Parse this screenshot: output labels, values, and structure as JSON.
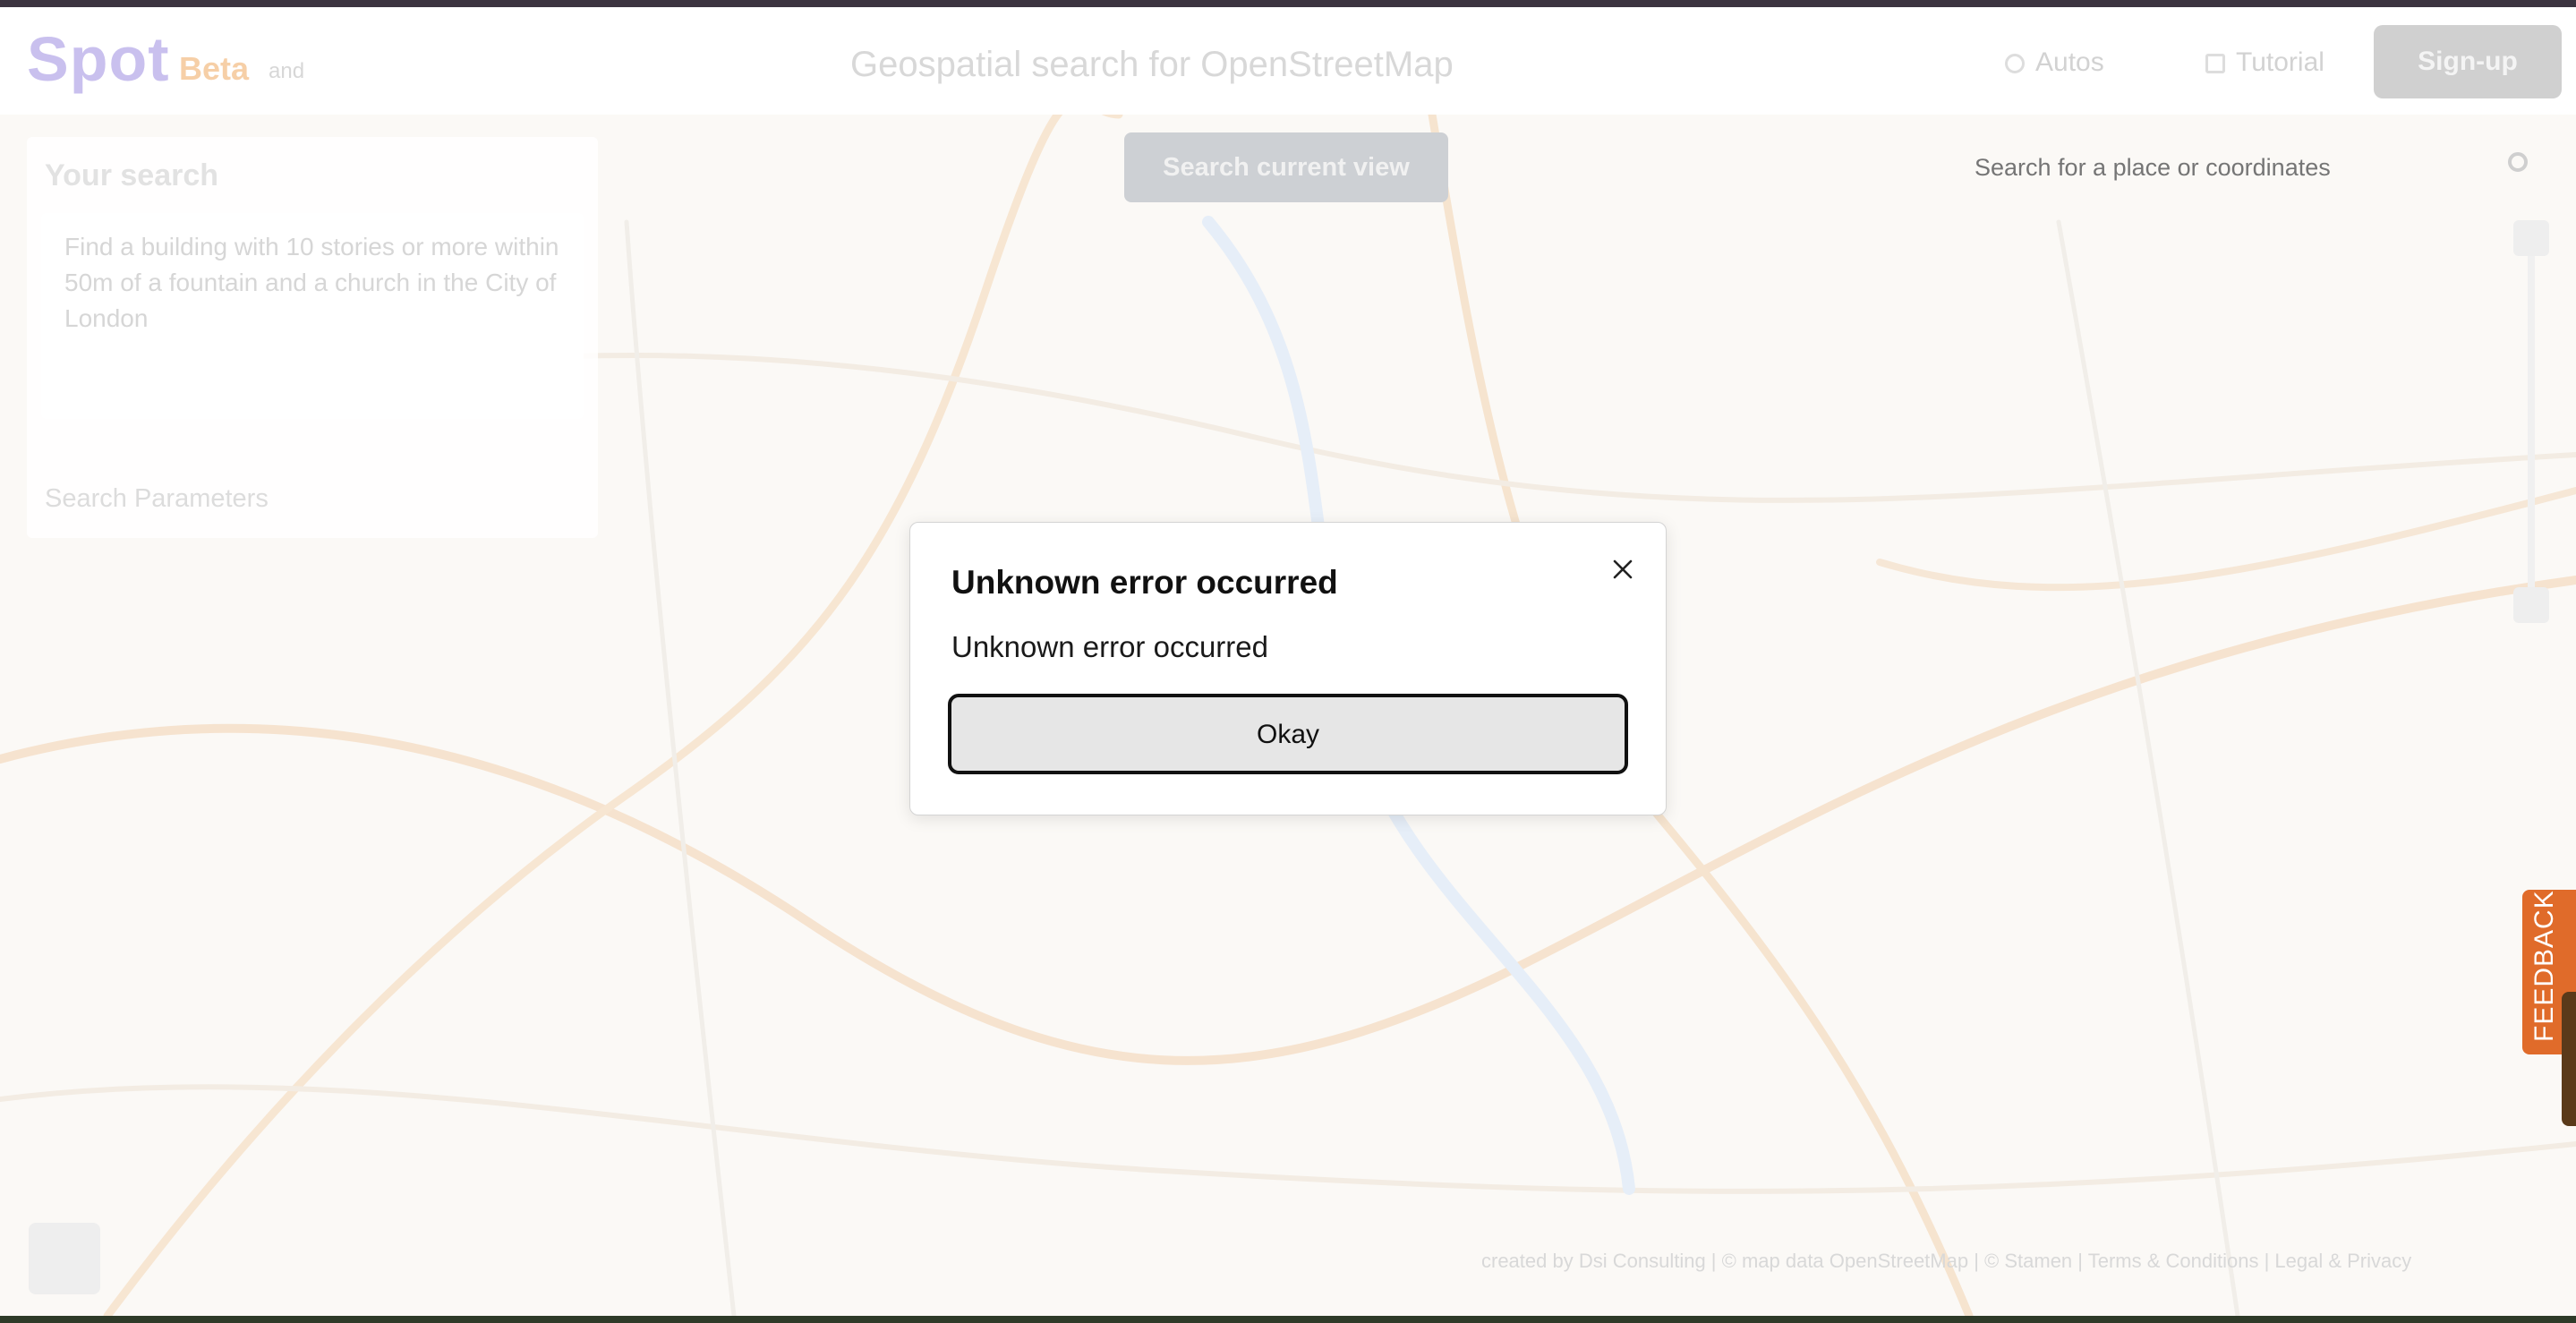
{
  "app": {
    "logo": "Spot",
    "logo_sub": "Beta",
    "logo_sub2": "and",
    "tagline": "Geospatial search for OpenStreetMap"
  },
  "nav": {
    "about_label": "Autos",
    "tutorial_label": "Tutorial",
    "signup_label": "Sign-up"
  },
  "map": {
    "search_map_button": "Search current view",
    "place_search_placeholder": "Search for a place or coordinates",
    "attribution": "created by Dsi Consulting | © map data OpenStreetMap | © Stamen | Terms & Conditions | Legal & Privacy"
  },
  "panel": {
    "title": "Your search",
    "query": "Find a building with 10 stories or more within 50m of a fountain and a church in the City of London",
    "params_label": "Search Parameters"
  },
  "feedback": {
    "label": "FEEDBACK"
  },
  "modal": {
    "title": "Unknown error occurred",
    "message": "Unknown error occurred",
    "okay_label": "Okay",
    "close_icon": "close-icon"
  },
  "colors": {
    "feedback": "#e06b2a",
    "okay_bg": "#e6e6e6",
    "logo": "#c9c0ee"
  }
}
